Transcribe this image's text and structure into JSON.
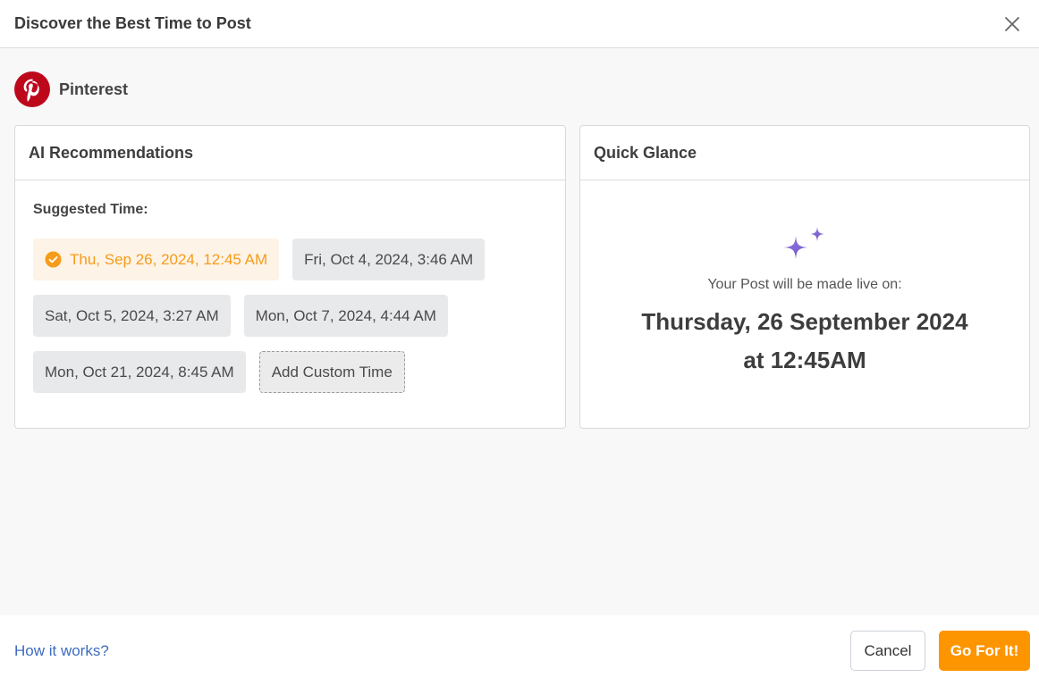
{
  "header": {
    "title": "Discover the Best Time to Post",
    "close_icon": "close-icon"
  },
  "platform": {
    "name": "Pinterest",
    "icon": "pinterest-logo-icon",
    "brand_color": "#bd081c"
  },
  "recommendations": {
    "title": "AI Recommendations",
    "suggested_label": "Suggested Time:",
    "slots": [
      {
        "label": "Thu, Sep 26, 2024, 12:45 AM",
        "selected": true
      },
      {
        "label": "Fri, Oct 4, 2024, 3:46 AM",
        "selected": false
      },
      {
        "label": "Sat, Oct 5, 2024, 3:27 AM",
        "selected": false
      },
      {
        "label": "Mon, Oct 7, 2024, 4:44 AM",
        "selected": false
      },
      {
        "label": "Mon, Oct 21, 2024, 8:45 AM",
        "selected": false
      }
    ],
    "custom_label": "Add Custom Time",
    "selected_color": "#f59c1a"
  },
  "quick_glance": {
    "title": "Quick Glance",
    "icon": "sparkles-icon",
    "live_on_label": "Your Post will be made live on:",
    "date": "Thursday, 26 September 2024",
    "time": "at 12:45AM",
    "icon_color": "#7b5fd0"
  },
  "footer": {
    "help_link": "How it works?",
    "cancel_label": "Cancel",
    "confirm_label": "Go For It!",
    "accent_color": "#fd9500"
  }
}
